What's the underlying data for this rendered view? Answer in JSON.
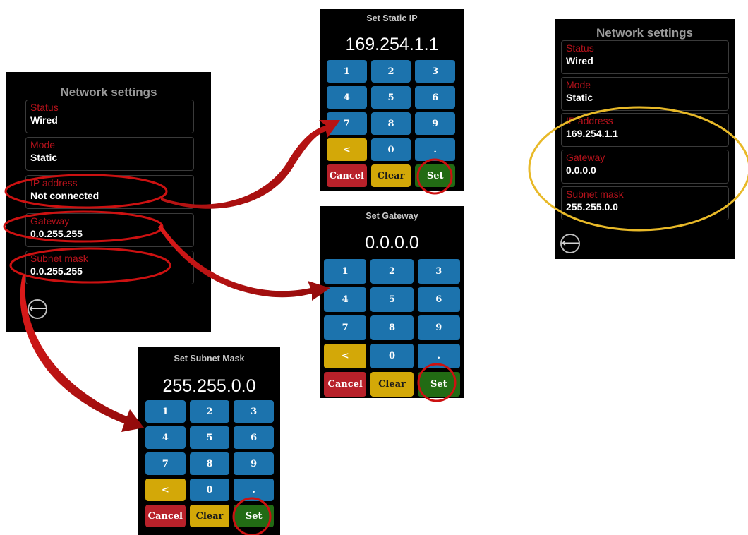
{
  "colors": {
    "panel_bg": "#000000",
    "label_red": "#b5121b",
    "key_blue": "#1c73ad",
    "key_yellow": "#d3a808",
    "key_red": "#b8212a",
    "key_green": "#226b14",
    "annotation_red": "#cc1111",
    "annotation_gold": "#e8b928"
  },
  "before": {
    "title": "Network settings",
    "fields": [
      {
        "label": "Status",
        "value": "Wired"
      },
      {
        "label": "Mode",
        "value": "Static"
      },
      {
        "label": "IP address",
        "value": "Not connected"
      },
      {
        "label": "Gateway",
        "value": "0.0.255.255"
      },
      {
        "label": "Subnet mask",
        "value": "0.0.255.255"
      }
    ],
    "back_icon": "back-arrow-icon",
    "back_glyph": "⟵"
  },
  "after": {
    "title": "Network settings",
    "fields": [
      {
        "label": "Status",
        "value": "Wired"
      },
      {
        "label": "Mode",
        "value": "Static"
      },
      {
        "label": "IP address",
        "value": "169.254.1.1"
      },
      {
        "label": "Gateway",
        "value": "0.0.0.0"
      },
      {
        "label": "Subnet mask",
        "value": "255.255.0.0"
      }
    ],
    "back_icon": "back-arrow-icon",
    "back_glyph": "⟵"
  },
  "keypads": {
    "ip": {
      "title": "Set Static IP",
      "display": "169.254.1.1"
    },
    "gateway": {
      "title": "Set Gateway",
      "display": "0.0.0.0"
    },
    "subnet": {
      "title": "Set Subnet Mask",
      "display": "255.255.0.0"
    }
  },
  "keys": {
    "digits": [
      "1",
      "2",
      "3",
      "4",
      "5",
      "6",
      "7",
      "8",
      "9"
    ],
    "backspace": "<",
    "zero": "0",
    "dot": ".",
    "cancel": "Cancel",
    "clear": "Clear",
    "set": "Set"
  }
}
